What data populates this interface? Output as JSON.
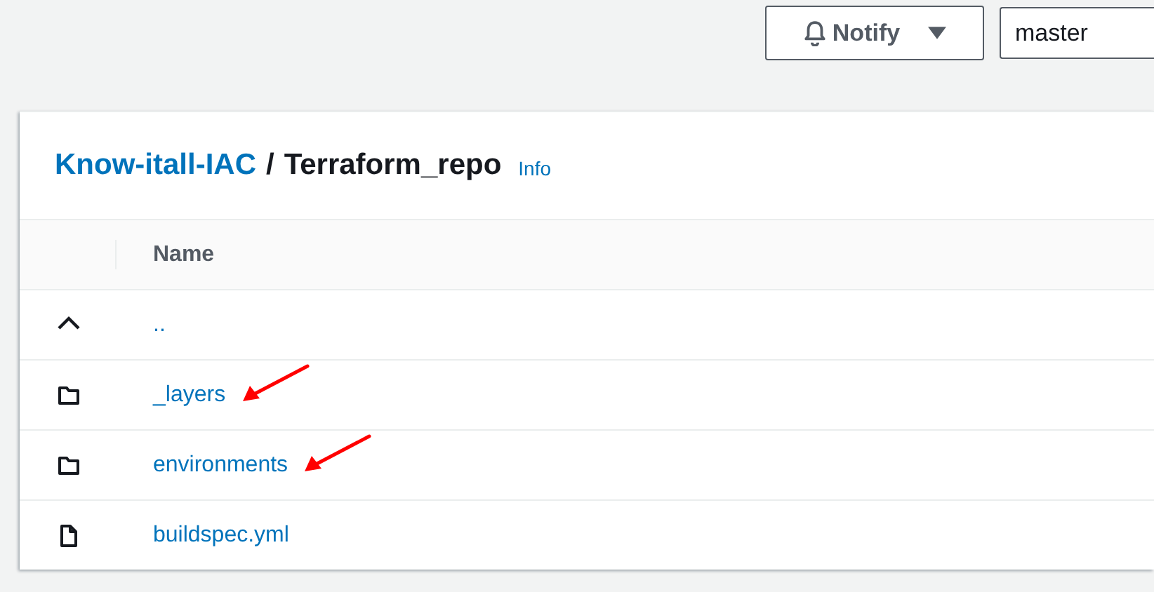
{
  "toolbar": {
    "notify_button": "Notify",
    "branch_field": {
      "value": "master"
    }
  },
  "breadcrumb": {
    "repository": "Know-itall-IAC",
    "separator": "/",
    "folder": "Terraform_repo",
    "info_link": "Info"
  },
  "table": {
    "columns": [
      "Name"
    ],
    "rows": [
      {
        "kind": "parent",
        "name": "..",
        "annotated": false
      },
      {
        "kind": "folder",
        "name": "_layers",
        "annotated": true
      },
      {
        "kind": "folder",
        "name": "environments",
        "annotated": true
      },
      {
        "kind": "file",
        "name": "buildspec.yml",
        "annotated": false
      }
    ]
  }
}
